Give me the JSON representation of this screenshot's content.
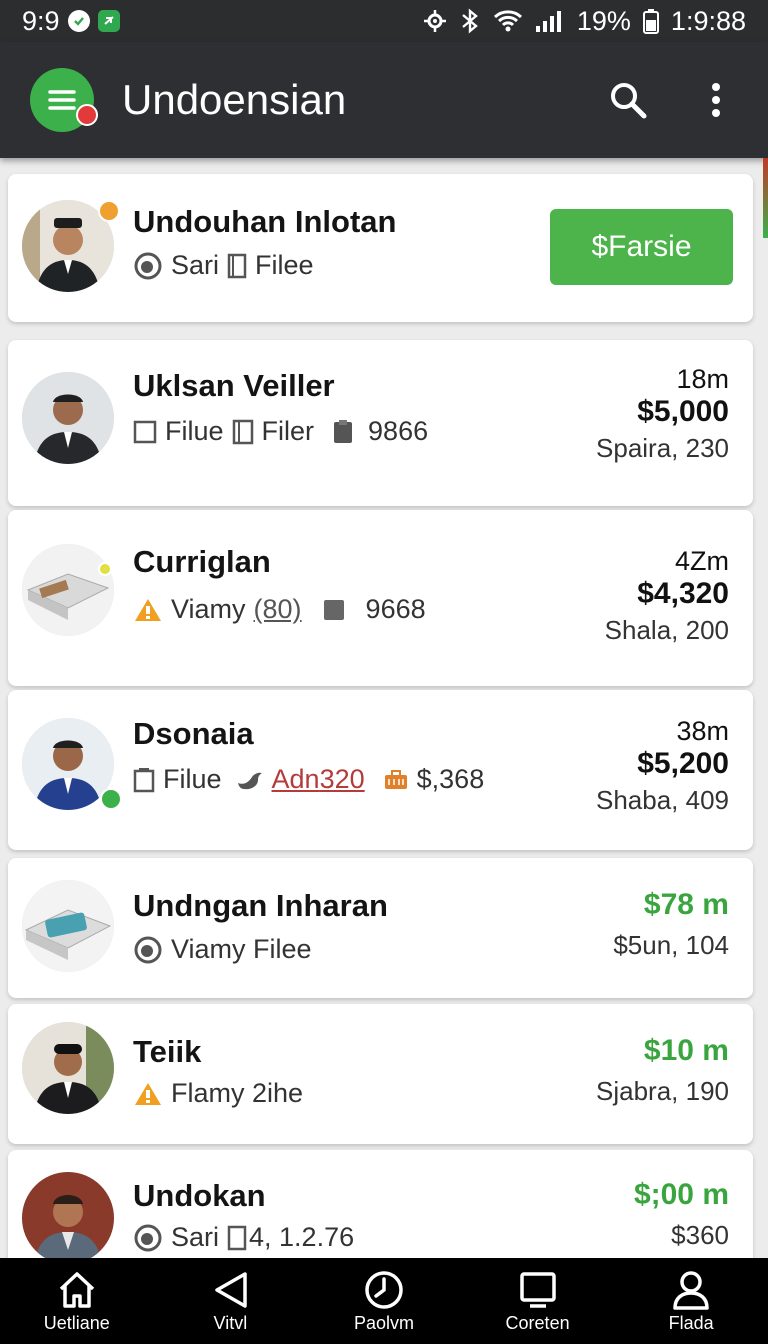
{
  "status_bar": {
    "time_left": "9:9",
    "battery": "19%",
    "time_right": "1:9:88"
  },
  "app_bar": {
    "title": "Undoensian"
  },
  "rows": [
    {
      "name": "Undouhan Inlotan",
      "meta": [
        "Sari",
        "Filee"
      ],
      "button": "$Farsie"
    },
    {
      "name": "Uklsan Veiller",
      "meta": [
        "Filue",
        "Filer",
        "9866"
      ],
      "time": "18m",
      "price": "$5,000",
      "sub": "Spaira, 230"
    },
    {
      "name": "Curriglan",
      "meta": [
        "Viamy",
        "(80)",
        "9668"
      ],
      "time": "4Zm",
      "price": "$4,320",
      "sub": "Shala, 200"
    },
    {
      "name": "Dsonaia",
      "meta": [
        "Filue",
        "Adn",
        "320",
        "$,368"
      ],
      "time": "38m",
      "price": "$5,200",
      "sub": "Shaba, 409"
    },
    {
      "name": "Undngan Inharan",
      "meta": [
        "Viamy Filee"
      ],
      "green": "$78 m",
      "sub": "$5un, 104"
    },
    {
      "name": "Teiik",
      "meta": [
        "Flamy 2ihe"
      ],
      "green": "$10 m",
      "sub": "Sjabra, 190"
    },
    {
      "name": "Undokan",
      "meta": [
        "Sari",
        "4, 1.2.76"
      ],
      "green": "$;00 m",
      "sub": "$360"
    }
  ],
  "bottom_nav": [
    {
      "label": "Uetliane",
      "icon": "home-icon"
    },
    {
      "label": "Vitvl",
      "icon": "back-icon"
    },
    {
      "label": "Paolvm",
      "icon": "clock-icon"
    },
    {
      "label": "Coreten",
      "icon": "square-icon"
    },
    {
      "label": "Flada",
      "icon": "person-icon"
    }
  ],
  "colors": {
    "accent_green": "#4cb44a",
    "price_green": "#3aa53f",
    "app_bar": "#2d2f32",
    "link_red": "#b53b3b"
  }
}
